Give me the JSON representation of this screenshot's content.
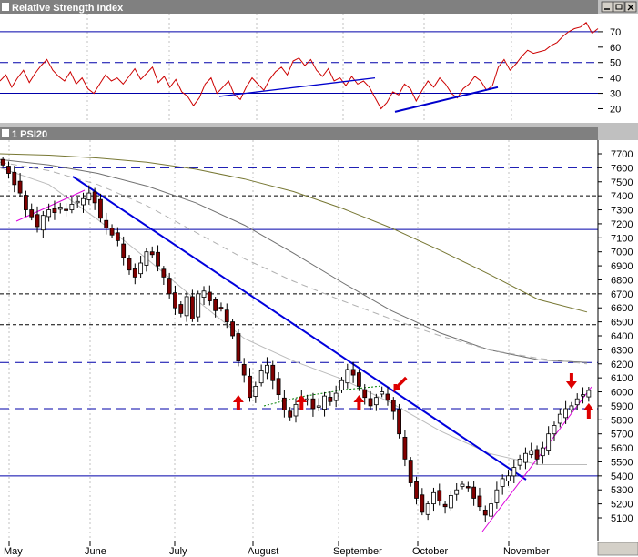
{
  "chart_data": [
    {
      "type": "line",
      "title": "Relative Strength Index",
      "ylim": [
        12,
        80
      ],
      "y_ticks": [
        "70",
        "60",
        "50",
        "40",
        "30",
        "20"
      ],
      "reference_lines": [
        {
          "value": 70,
          "style": "solid",
          "color": "#0000aa"
        },
        {
          "value": 50,
          "style": "dashed",
          "color": "#0000aa"
        },
        {
          "value": 30,
          "style": "solid",
          "color": "#0000aa"
        }
      ],
      "series": [
        {
          "color": "#cc0000",
          "values": [
            38,
            42,
            34,
            40,
            45,
            37,
            43,
            48,
            52,
            45,
            41,
            38,
            44,
            36,
            40,
            33,
            30,
            36,
            42,
            38,
            40,
            36,
            41,
            46,
            39,
            43,
            47,
            37,
            41,
            34,
            39,
            31,
            28,
            22,
            27,
            36,
            40,
            30,
            34,
            38,
            29,
            26,
            34,
            40,
            36,
            32,
            39,
            44,
            47,
            42,
            51,
            53,
            48,
            52,
            45,
            41,
            46,
            38,
            40,
            35,
            41,
            36,
            38,
            34,
            27,
            20,
            24,
            31,
            29,
            36,
            33,
            25,
            32,
            38,
            34,
            40,
            36,
            30,
            27,
            33,
            36,
            41,
            38,
            32,
            35,
            47,
            52,
            45,
            49,
            54,
            58,
            56,
            57,
            58,
            61,
            63,
            67,
            70,
            72,
            73,
            76,
            69,
            72
          ]
        }
      ],
      "trendlines": [
        {
          "from": [
            241,
            28
          ],
          "to": [
            412,
            40
          ],
          "color": "#0000cc"
        },
        {
          "from": [
            434,
            18
          ],
          "to": [
            547,
            34
          ],
          "color": "#0000cc"
        }
      ]
    },
    {
      "type": "candlestick",
      "title": "1 PSI20",
      "ylim": [
        5000,
        7800
      ],
      "y_ticks": [
        "7700",
        "7600",
        "7500",
        "7400",
        "7300",
        "7200",
        "7100",
        "7000",
        "6900",
        "6800",
        "6700",
        "6600",
        "6500",
        "6400",
        "6300",
        "6200",
        "6100",
        "6000",
        "5900",
        "5800",
        "5700",
        "5600",
        "5500",
        "5400",
        "5300",
        "5200",
        "5100"
      ],
      "x_ticks": [
        "May",
        "June",
        "July",
        "August",
        "September",
        "October",
        "November"
      ],
      "reference_lines": [
        {
          "value": 7600,
          "style": "dashed",
          "color": "#0000aa"
        },
        {
          "value": 7400,
          "style": "dashed",
          "color": "#000000"
        },
        {
          "value": 7160,
          "style": "solid",
          "color": "#0000aa"
        },
        {
          "value": 6700,
          "style": "dashed",
          "color": "#000000"
        },
        {
          "value": 6480,
          "style": "dashed",
          "color": "#000000"
        },
        {
          "value": 6210,
          "style": "dashed",
          "color": "#0000aa"
        },
        {
          "value": 5880,
          "style": "dashed",
          "color": "#0000aa"
        },
        {
          "value": 5400,
          "style": "solid",
          "color": "#0000aa"
        }
      ],
      "closes": [
        7620,
        7560,
        7480,
        7420,
        7300,
        7250,
        7180,
        7260,
        7300,
        7280,
        7320,
        7300,
        7340,
        7360,
        7380,
        7420,
        7350,
        7240,
        7170,
        7120,
        7080,
        6960,
        6870,
        6820,
        6920,
        7000,
        6980,
        6900,
        6820,
        6700,
        6600,
        6560,
        6680,
        6520,
        6700,
        6720,
        6650,
        6580,
        6600,
        6500,
        6400,
        6220,
        6120,
        5960,
        6040,
        6150,
        6190,
        6080,
        5980,
        5870,
        5820,
        5910,
        5960,
        5950,
        5880,
        5900,
        5970,
        5930,
        5990,
        6080,
        6160,
        6120,
        6040,
        5960,
        5900,
        5960,
        6000,
        5940,
        5860,
        5700,
        5520,
        5350,
        5240,
        5140,
        5200,
        5280,
        5220,
        5180,
        5260,
        5300,
        5340,
        5320,
        5240,
        5180,
        5120,
        5200,
        5300,
        5380,
        5400,
        5460,
        5520,
        5560,
        5580,
        5520,
        5600,
        5700,
        5760,
        5840,
        5880,
        5900,
        5950,
        5980,
        6010
      ],
      "moving_averages": [
        {
          "color": "#777733",
          "values": [
            7700,
            7690,
            7670,
            7640,
            7590,
            7520,
            7430,
            7310,
            7170,
            7010,
            6840,
            6660,
            6570
          ]
        },
        {
          "color": "#707070",
          "values": [
            7660,
            7620,
            7560,
            7470,
            7350,
            7190,
            6990,
            6780,
            6580,
            6420,
            6300,
            6230,
            6210
          ]
        },
        {
          "color": "#b0b0b0",
          "dashed": true,
          "values": [
            7640,
            7580,
            7480,
            7330,
            7140,
            6950,
            6790,
            6650,
            6520,
            6400,
            6300,
            6240,
            6200
          ]
        },
        {
          "color": "#bbbbbb",
          "values": [
            7600,
            7480,
            7230,
            6950,
            6660,
            6380,
            6220,
            6090,
            5920,
            5720,
            5560,
            5480,
            5480
          ]
        }
      ],
      "annotations": [
        {
          "type": "up-arrow",
          "x_day": 41,
          "color": "#dd0000"
        },
        {
          "type": "up-arrow",
          "x_day": 52,
          "color": "#dd0000"
        },
        {
          "type": "up-arrow",
          "x_day": 62,
          "color": "#dd0000"
        },
        {
          "type": "x-mark",
          "x_day": 68,
          "color": "#dd0000"
        },
        {
          "type": "down-arrow",
          "x_day": 99,
          "color": "#dd0000"
        },
        {
          "type": "up-arrow",
          "x_day": 102,
          "color": "#dd0000"
        }
      ]
    }
  ]
}
